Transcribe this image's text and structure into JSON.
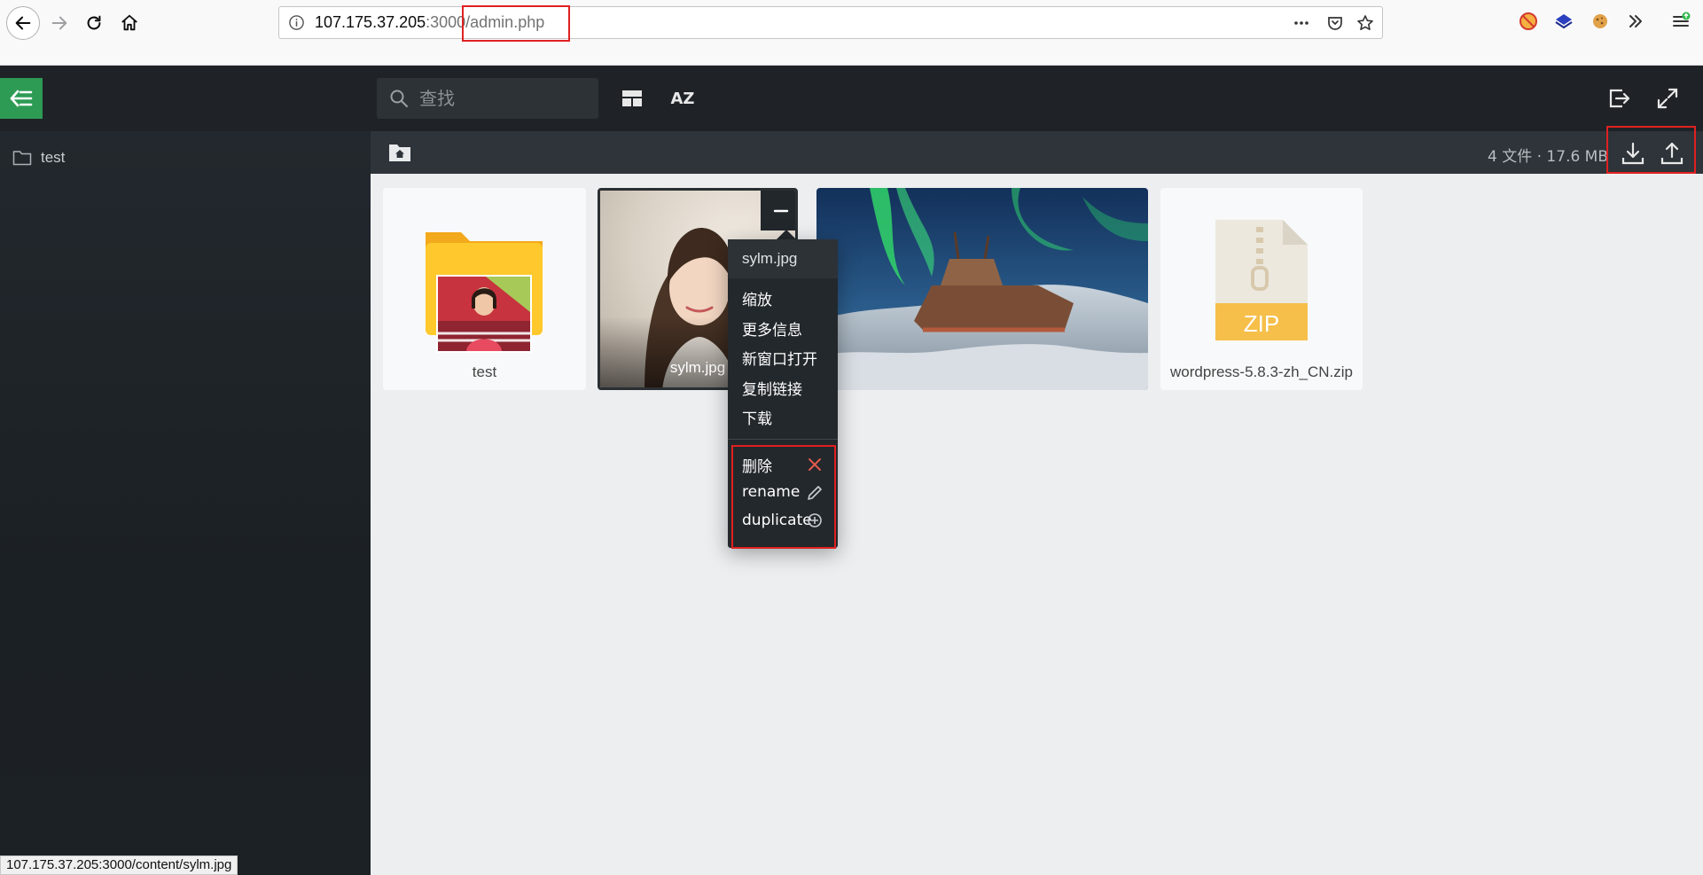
{
  "browser": {
    "url_host": "107.175.37.205",
    "url_rest": ":3000/admin.php",
    "status_url": "107.175.37.205:3000/content/sylm.jpg"
  },
  "app": {
    "search_placeholder": "查找",
    "sort_label": "AZ",
    "sidebar_folder": "test"
  },
  "toolbar": {
    "file_stats": "4 文件 · 17.6 MB"
  },
  "files": [
    {
      "label": "test",
      "type": "folder"
    },
    {
      "label": "sylm.jpg",
      "type": "image"
    },
    {
      "label": "",
      "type": "image"
    },
    {
      "label": "wordpress-5.8.3-zh_CN.zip",
      "type": "zip",
      "badge": "ZIP"
    }
  ],
  "context_menu": {
    "title": "sylm.jpg",
    "items": [
      "缩放",
      "更多信息",
      "新窗口打开",
      "复制链接",
      "下载"
    ],
    "actions": [
      "删除",
      "rename",
      "duplicate"
    ]
  },
  "colors": {
    "accent_green": "#2e9b55",
    "highlight_red": "#e02020",
    "delete_icon": "#e25a4e"
  }
}
